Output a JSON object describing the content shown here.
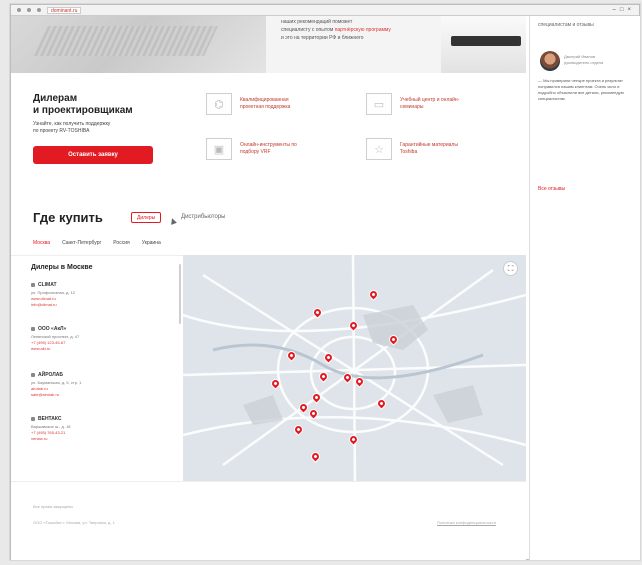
{
  "browser": {
    "url": "dominant.ru"
  },
  "hero": {
    "line1": "наших рекомендаций поможет",
    "line2": "специалисту с опытом",
    "link": "партнёрскую программу",
    "line3": "и это на территории РФ и ближнего"
  },
  "dealers_block": {
    "title_l1": "Дилерам",
    "title_l2": "и проектировщикам",
    "subtitle_l1": "Узнайте, как получить поддержку",
    "subtitle_l2": "по проекту RV-TOSHIBA",
    "cta": "Оставить заявку",
    "features": [
      {
        "icon": "structure-icon",
        "label": "Квалифицированная проектная поддержка"
      },
      {
        "icon": "book-icon",
        "label": "Учебный центр и онлайн-семинары"
      },
      {
        "icon": "monitor-icon",
        "label": "Онлайн-инструменты по подбору VRF"
      },
      {
        "icon": "badge-icon",
        "label": "Гарантийные материалы Toshiba"
      }
    ]
  },
  "where_to_buy": {
    "title": "Где купить",
    "tab_active": "Дилеры",
    "tab_other": "Дистрибьюторы",
    "cities": [
      "Москва",
      "Санкт-Петербург",
      "Россия",
      "Украина"
    ]
  },
  "dealer_list": {
    "title": "Дилеры в Москве",
    "items": [
      {
        "name": "CLIMAT",
        "addr": "ул. Профсоюзная, д. 12",
        "link1": "www.climat.ru",
        "link2": "info@climat.ru"
      },
      {
        "name": "ООО «АкЛ»",
        "addr": "Ленинский проспект, д. 47",
        "link1": "+7 (495) 123-45-67",
        "link2": "www.akl.ru"
      },
      {
        "name": "АЙРОЛАБ",
        "addr": "ул. Бауманская, д. 5, стр. 1",
        "link1": "airolab.ru",
        "link2": "sale@airolab.ru"
      },
      {
        "name": "ВЕНТАКС",
        "addr": "Варшавское ш., д. 18",
        "link1": "+7 (495) 765-43-21",
        "link2": "ventax.ru"
      }
    ]
  },
  "footer": {
    "a": "Все права защищены",
    "b": "ООО «Тошиба» г. Москва, ул. Тверская, д. 1",
    "c": "Политика конфиденциальности"
  },
  "sidebar": {
    "top": "специалистам и отзывы",
    "who_l1": "Дмитрий Иванов",
    "who_l2": "руководитель отдела",
    "quote": "— Мы проверили четыре проекта и результат понравился нашим клиентам. Очень ясно и подробно объяснили все детали, рекомендую специалистам.",
    "more": "Все отзывы"
  },
  "colors": {
    "accent": "#e21b23"
  }
}
